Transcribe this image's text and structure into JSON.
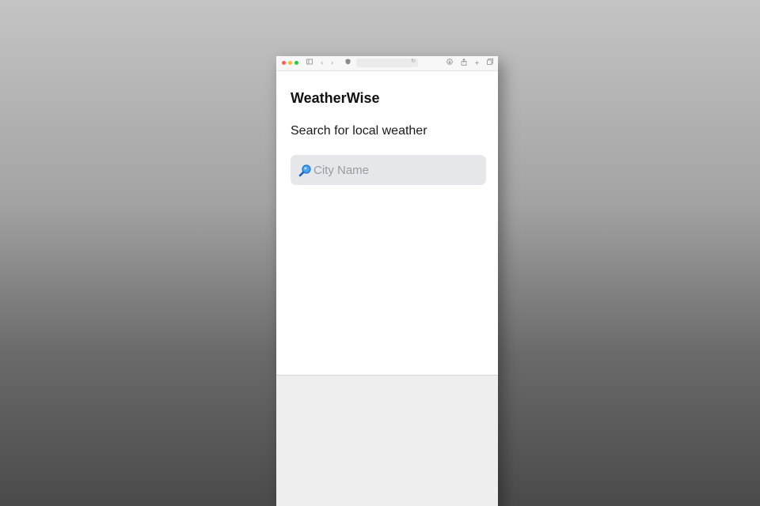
{
  "browser": {
    "traffic_colors": [
      "#ff5f57",
      "#febc2e",
      "#28c840"
    ],
    "icons": {
      "sidebar": "sidebar-icon",
      "back": "chevron-left-icon",
      "forward": "chevron-right-icon",
      "shield": "shield-icon",
      "reload": "reload-icon",
      "download": "download-icon",
      "share": "share-icon",
      "new_tab": "plus-icon",
      "tabs": "tabs-overview-icon"
    }
  },
  "app": {
    "title": "WeatherWise",
    "subtitle": "Search for local weather",
    "search": {
      "placeholder": "City Name",
      "value": "",
      "icon": "magnifier-icon"
    }
  }
}
